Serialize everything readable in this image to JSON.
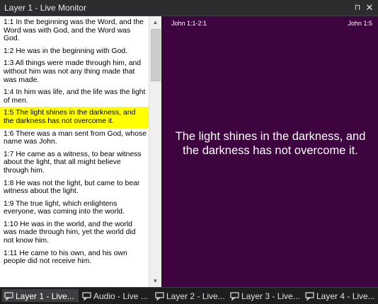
{
  "window": {
    "title": "Layer 1 - Live Monitor",
    "pin_glyph": "⊓",
    "close_glyph": "✕"
  },
  "verses": [
    {
      "text": "1:1 In the beginning was the Word, and the Word was with God, and the Word was God."
    },
    {
      "text": "1:2 He was in the beginning with God."
    },
    {
      "text": "1:3 All things were made through him, and without him was not any thing made that was made."
    },
    {
      "text": "1:4 In him was life,  and the life was the light of men."
    },
    {
      "text": "1:5 The light shines in the darkness, and the darkness has not overcome it.",
      "selected": true
    },
    {
      "text": "1:6 There was a man sent from God, whose name was John."
    },
    {
      "text": "1:7 He came as a witness, to bear witness about the light, that all might believe through him."
    },
    {
      "text": "1:8 He was not the light, but came to bear witness about the light."
    },
    {
      "text": "1:9 The true light, which enlightens everyone, was coming into the world."
    },
    {
      "text": "1:10 He was in the world, and the world was made through him, yet the world did not know him."
    },
    {
      "text": "1:11 He came to his own,  and his own people  did not receive him."
    }
  ],
  "scrollbar": {
    "up_glyph": "▲",
    "down_glyph": "▼"
  },
  "preview": {
    "range_label": "John 1:1-2:1",
    "current_ref": "John 1:5",
    "slide_text": "The light shines in the darkness, and the darkness has not overcome it.",
    "background": "#3d0440"
  },
  "tabs": [
    {
      "label": "Layer 1 - Live...",
      "active": true
    },
    {
      "label": "Audio - Live ..."
    },
    {
      "label": "Layer 2 - Live..."
    },
    {
      "label": "Layer 3 - Live..."
    },
    {
      "label": "Layer 4 - Live..."
    }
  ],
  "colors": {
    "highlight": "#ffff00",
    "accent": "#3d0440"
  }
}
